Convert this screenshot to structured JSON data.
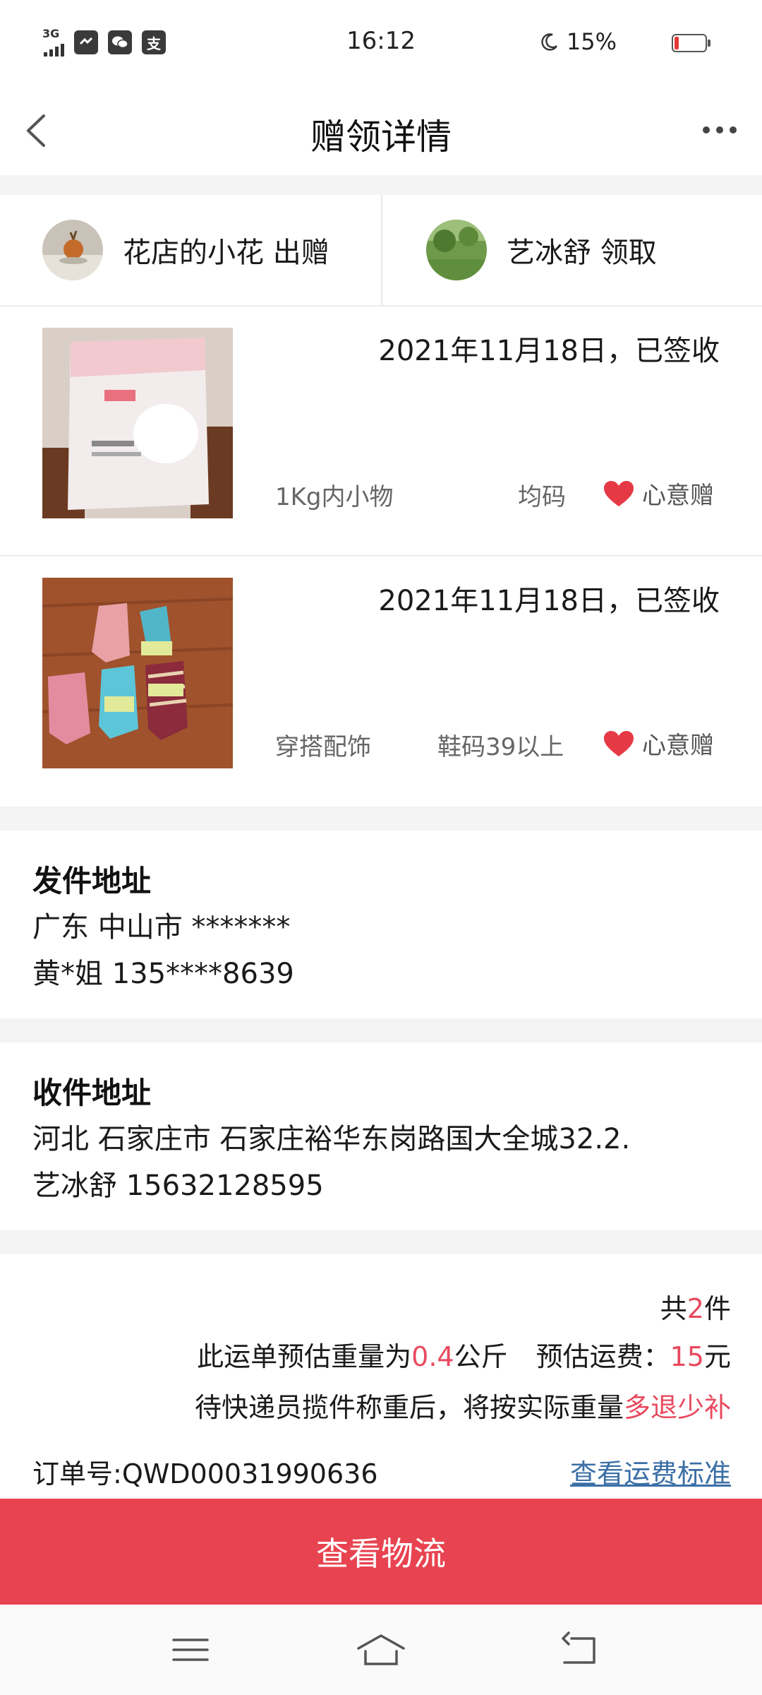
{
  "status_bar": {
    "network": "3G",
    "time": "16:12",
    "battery_percent": "15%",
    "battery_level": 0.15,
    "notification_icons": [
      "app-icon",
      "wechat-icon",
      "alipay-icon"
    ],
    "alipay_glyph": "支"
  },
  "nav": {
    "title": "赠领详情",
    "back_icon": "chevron-left-icon",
    "more_icon": "more-dots-icon"
  },
  "parties": {
    "giver": "花店的小花 出赠",
    "receiver": "艺冰舒 领取"
  },
  "items": [
    {
      "status": "2021年11月18日，已签收",
      "category": "1Kg内小物",
      "size": "均码",
      "tag": "心意赠",
      "image_label": "product-photo-pads-bag"
    },
    {
      "status": "2021年11月18日，已签收",
      "category": "穿搭配饰",
      "size": "鞋码39以上",
      "tag": "心意赠",
      "image_label": "product-photo-socks"
    }
  ],
  "sender_address": {
    "title": "发件地址",
    "line1": "广东 中山市 *******",
    "line2": "黄*姐 135****8639"
  },
  "receiver_address": {
    "title": "收件地址",
    "line1": "河北 石家庄市 石家庄裕华东岗路国大全城32.2.",
    "line2": "艺冰舒 15632128595"
  },
  "summary": {
    "count_prefix": "共",
    "count": "2",
    "count_suffix": "件",
    "weight_prefix": "此运单预估重量为",
    "weight_value": "0.4",
    "weight_unit": "公斤",
    "fee_prefix": "预估运费：",
    "fee_value": "15",
    "fee_unit": "元",
    "note_prefix": "待快递员揽件称重后，将按实际重量",
    "note_highlight": "多退少补",
    "order_label": "订单号:",
    "order_number": "QWD00031990636",
    "fee_standard_link": "查看运费标准"
  },
  "actions": {
    "logistics_button": "查看物流"
  },
  "system_nav": [
    "menu-icon",
    "home-icon",
    "back-icon"
  ],
  "colors": {
    "accent_red": "#e84350",
    "highlight_red": "#e84a5f",
    "link_blue": "#3b6fa6",
    "divider": "#f4f4f4"
  }
}
